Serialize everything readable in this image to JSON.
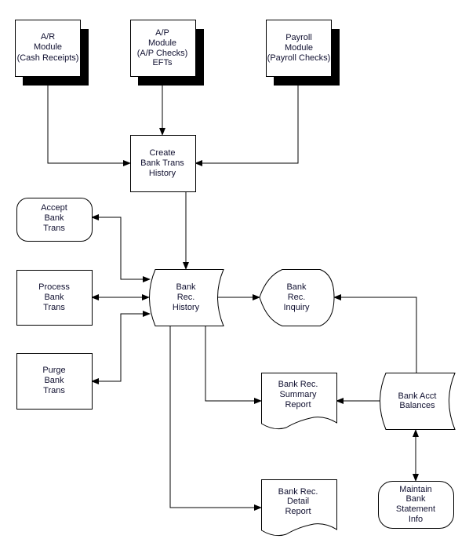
{
  "nodes": {
    "ar": [
      "A/R",
      "Module",
      "(Cash Receipts)"
    ],
    "ap": [
      "A/P",
      "Module",
      "(A/P Checks)",
      "EFTs"
    ],
    "payroll": [
      "Payroll",
      "Module",
      "(Payroll Checks)"
    ],
    "create": [
      "Create",
      "Bank Trans",
      "History"
    ],
    "accept": [
      "Accept",
      "Bank",
      "Trans"
    ],
    "process": [
      "Process",
      "Bank",
      "Trans"
    ],
    "purge": [
      "Purge",
      "Bank",
      "Trans"
    ],
    "history": [
      "Bank",
      "Rec.",
      "History"
    ],
    "inquiry": [
      "Bank",
      "Rec.",
      "Inquiry"
    ],
    "summary": [
      "Bank Rec.",
      "Summary",
      "Report"
    ],
    "balances": [
      "Bank Acct",
      "Balances"
    ],
    "detail": [
      "Bank Rec.",
      "Detail",
      "Report"
    ],
    "maintain": [
      "Maintain",
      "Bank",
      "Statement",
      "Info"
    ]
  }
}
